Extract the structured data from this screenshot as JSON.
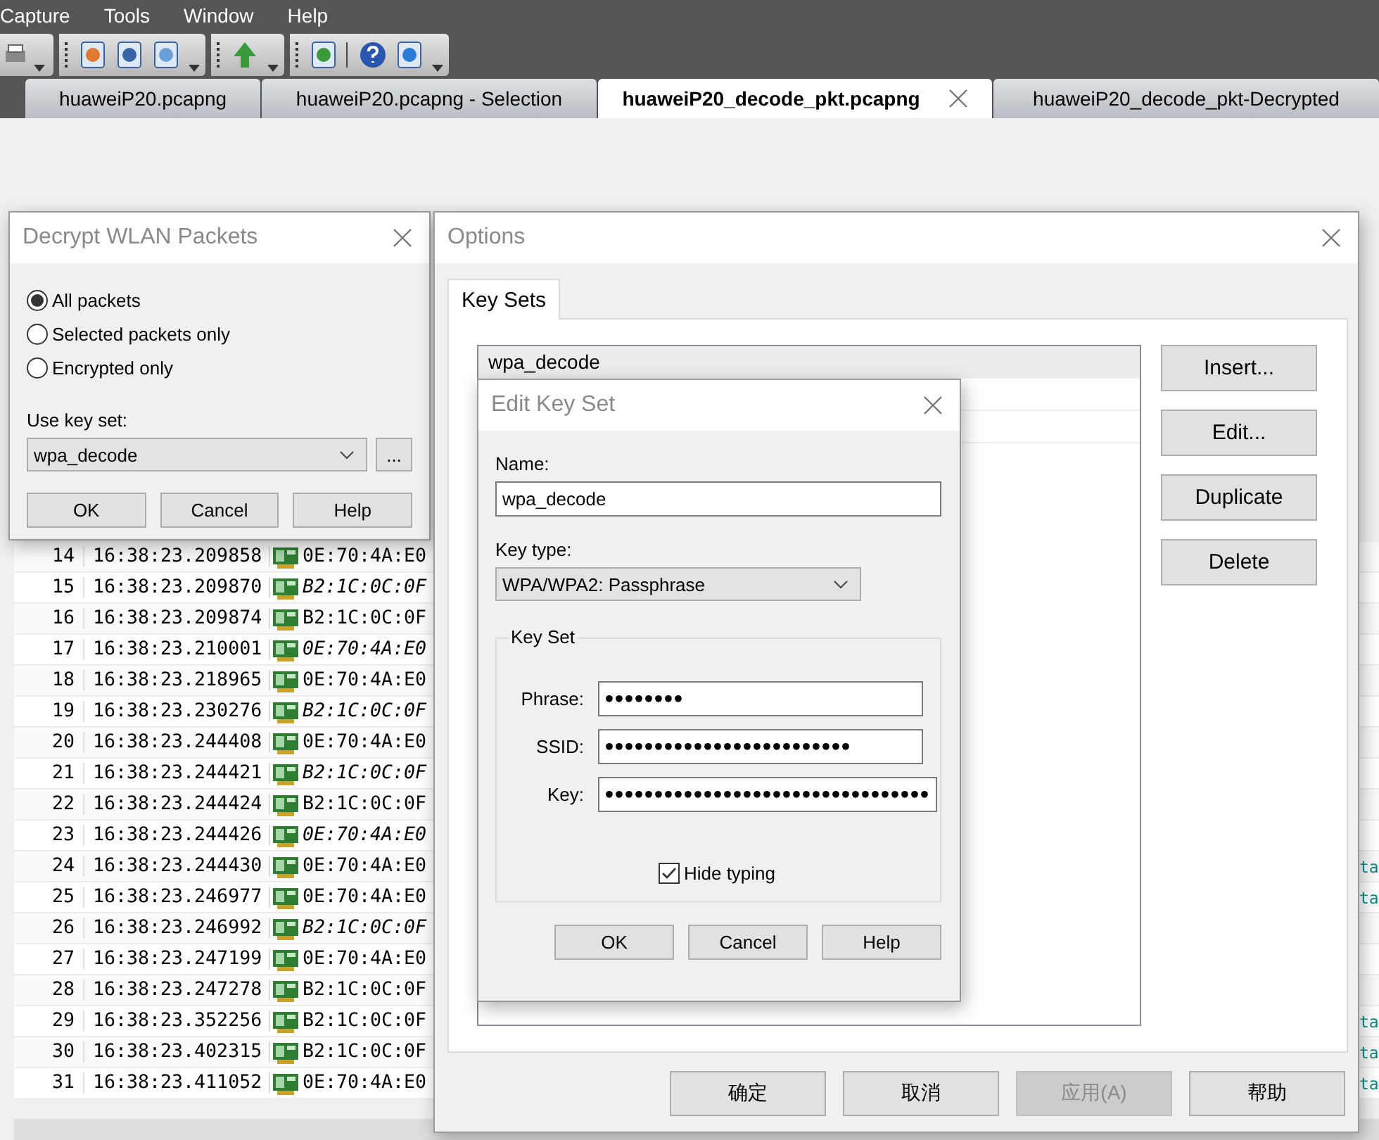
{
  "menu": [
    "Capture",
    "Tools",
    "Window",
    "Help"
  ],
  "tabs": [
    {
      "label": "huaweiP20.pcapng",
      "selected": false
    },
    {
      "label": "huaweiP20.pcapng - Selection",
      "selected": false
    },
    {
      "label": "huaweiP20_decode_pkt.pcapng",
      "selected": true
    },
    {
      "label": "huaweiP20_decode_pkt-Decrypted",
      "selected": false
    }
  ],
  "packets": [
    {
      "no": "14",
      "time": "16:38:23.209858",
      "source": "0E:70:4A:E0",
      "italic": false
    },
    {
      "no": "15",
      "time": "16:38:23.209870",
      "source": "B2:1C:0C:0F",
      "italic": true
    },
    {
      "no": "16",
      "time": "16:38:23.209874",
      "source": "B2:1C:0C:0F",
      "italic": false
    },
    {
      "no": "17",
      "time": "16:38:23.210001",
      "source": "0E:70:4A:E0",
      "italic": true
    },
    {
      "no": "18",
      "time": "16:38:23.218965",
      "source": "0E:70:4A:E0",
      "italic": false
    },
    {
      "no": "19",
      "time": "16:38:23.230276",
      "source": "B2:1C:0C:0F",
      "italic": true
    },
    {
      "no": "20",
      "time": "16:38:23.244408",
      "source": "0E:70:4A:E0",
      "italic": false
    },
    {
      "no": "21",
      "time": "16:38:23.244421",
      "source": "B2:1C:0C:0F",
      "italic": true
    },
    {
      "no": "22",
      "time": "16:38:23.244424",
      "source": "B2:1C:0C:0F",
      "italic": false
    },
    {
      "no": "23",
      "time": "16:38:23.244426",
      "source": "0E:70:4A:E0",
      "italic": true
    },
    {
      "no": "24",
      "time": "16:38:23.244430",
      "source": "0E:70:4A:E0",
      "italic": false,
      "column_4": "ta"
    },
    {
      "no": "25",
      "time": "16:38:23.246977",
      "source": "0E:70:4A:E0",
      "italic": false,
      "column_4": "ta"
    },
    {
      "no": "26",
      "time": "16:38:23.246992",
      "source": "B2:1C:0C:0F",
      "italic": true
    },
    {
      "no": "27",
      "time": "16:38:23.247199",
      "source": "0E:70:4A:E0",
      "italic": false
    },
    {
      "no": "28",
      "time": "16:38:23.247278",
      "source": "B2:1C:0C:0F",
      "italic": false
    },
    {
      "no": "29",
      "time": "16:38:23.352256",
      "source": "B2:1C:0C:0F",
      "italic": false,
      "column_4": "ta"
    },
    {
      "no": "30",
      "time": "16:38:23.402315",
      "source": "B2:1C:0C:0F",
      "italic": false,
      "column_4": "ta"
    },
    {
      "no": "31",
      "time": "16:38:23.411052",
      "source": "0E:70:4A:E0",
      "italic": false,
      "column_4": "ta"
    }
  ],
  "decrypt_dialog": {
    "title": "Decrypt WLAN Packets",
    "options": [
      {
        "label": "All packets",
        "selected": true
      },
      {
        "label": "Selected packets only",
        "selected": false
      },
      {
        "label": "Encrypted only",
        "selected": false
      }
    ],
    "key_set_label": "Use key set:",
    "key_set_value": "wpa_decode",
    "browse_button": "...",
    "buttons": [
      "OK",
      "Cancel",
      "Help"
    ]
  },
  "options_dialog": {
    "title": "Options",
    "tabs": [
      {
        "label": "Key Sets",
        "selected": true
      }
    ],
    "key_sets": [
      {
        "name": "wpa_decode",
        "selected": true
      }
    ],
    "side_buttons": [
      "Insert...",
      "Edit...",
      "Duplicate",
      "Delete"
    ],
    "buttons": [
      {
        "label": "确定",
        "disabled": false
      },
      {
        "label": "取消",
        "disabled": false
      },
      {
        "label": "应用(A)",
        "disabled": true
      },
      {
        "label": "帮助",
        "disabled": false
      }
    ]
  },
  "edit_dialog": {
    "title": "Edit Key Set",
    "name_label": "Name:",
    "name_value": "wpa_decode",
    "key_type_label": "Key type:",
    "key_type_value": "WPA/WPA2: Passphrase",
    "group_title": "Key Set",
    "fields": [
      {
        "label": "Phrase:",
        "value": "••••••••"
      },
      {
        "label": "SSID:",
        "value": "•••••••••••••••••••••••••"
      },
      {
        "label": "Key:",
        "value": "•••••••••••••••••••••••••••••••••"
      }
    ],
    "hide_typing": {
      "label": "Hide typing",
      "checked": true
    },
    "buttons": [
      "OK",
      "Cancel",
      "Help"
    ]
  }
}
